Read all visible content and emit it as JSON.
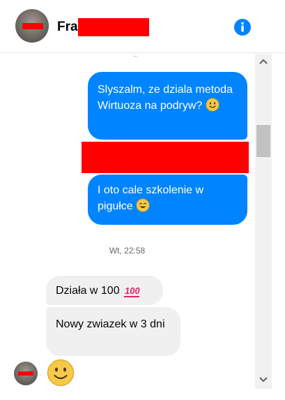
{
  "header": {
    "contact_name_visible": "Fra",
    "info_icon": "info-icon"
  },
  "messages": [
    {
      "direction": "out",
      "text": "Slyszalm, ze dziala metoda Wirtuoza na podryw?",
      "emoji": "slightly-smiling-face"
    },
    {
      "direction": "out",
      "redacted": true
    },
    {
      "direction": "out",
      "text": "I oto cale szkolenie w pigułce",
      "emoji": "smiling-face"
    }
  ],
  "timestamp": "Wt, 22:58",
  "replies": [
    {
      "direction": "in",
      "text": "Działa w 100",
      "emoji": "hundred-points"
    },
    {
      "direction": "in",
      "text": "Nowy zwiazek w 3 dni"
    },
    {
      "direction": "in",
      "emoji": "slightly-smiling-face-large"
    }
  ],
  "colors": {
    "outgoing_bubble": "#0084ff",
    "incoming_bubble": "#f0f0f0",
    "redaction": "#ff0000",
    "accent": "#0084ff"
  }
}
